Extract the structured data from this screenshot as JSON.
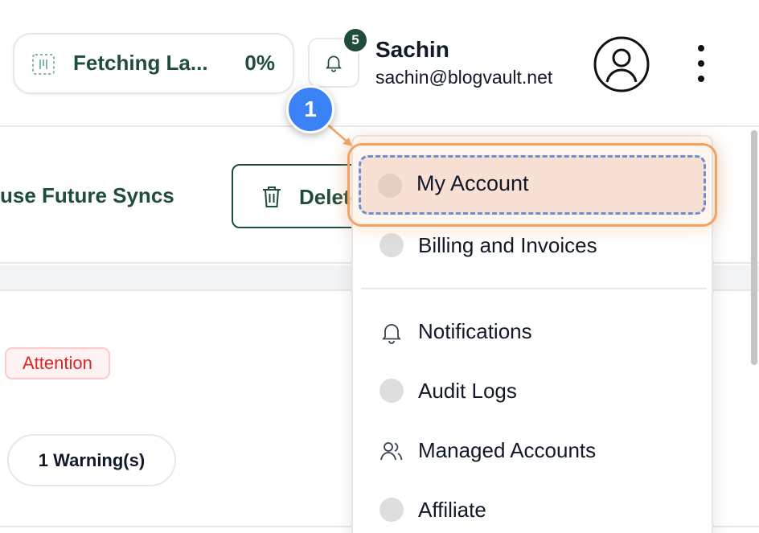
{
  "header": {
    "fetch_status": {
      "label": "Fetching La...",
      "percent": "0%"
    },
    "notifications": {
      "badge_count": "5"
    },
    "user": {
      "name": "Sachin",
      "email": "sachin@blogvault.net"
    }
  },
  "actions": {
    "pause_label": "use Future Syncs",
    "delete_label": "Delete"
  },
  "content": {
    "attention_badge": "Attention",
    "warning_pill": "1 Warning(s)"
  },
  "menu": {
    "items": [
      {
        "label": "My Account",
        "icon": "dot",
        "highlighted": true
      },
      {
        "label": "Billing and Invoices",
        "icon": "dot"
      },
      {
        "label": "Notifications",
        "icon": "bell-icon"
      },
      {
        "label": "Audit Logs",
        "icon": "dot"
      },
      {
        "label": "Managed Accounts",
        "icon": "users-icon"
      },
      {
        "label": "Affiliate",
        "icon": "dot"
      }
    ]
  },
  "annotation": {
    "step_number": "1"
  },
  "colors": {
    "brand_green": "#1f4d3a",
    "highlight_orange": "#f4a261",
    "step_blue": "#3b82f6",
    "attention_red": "#dc2626"
  }
}
